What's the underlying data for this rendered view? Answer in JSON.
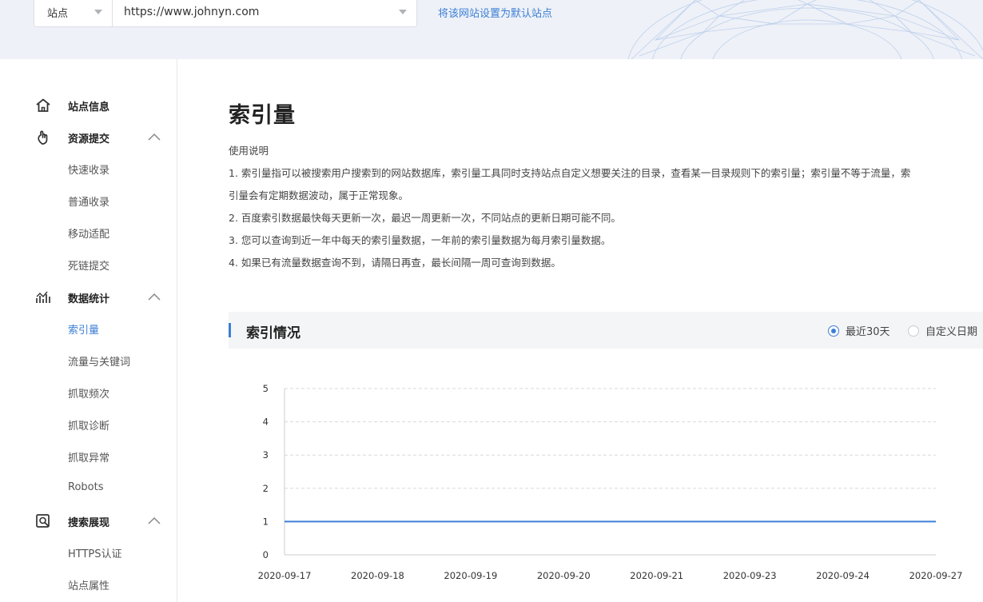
{
  "header": {
    "site_type": "站点",
    "site_url": "https://www.johnyn.com",
    "set_default_link": "将该网站设置为默认站点"
  },
  "sidebar": {
    "groups": [
      {
        "label": "站点信息",
        "icon": "home-icon"
      },
      {
        "label": "资源提交",
        "icon": "submit-icon",
        "items": [
          "快速收录",
          "普通收录",
          "移动适配",
          "死链提交"
        ]
      },
      {
        "label": "数据统计",
        "icon": "stats-icon",
        "items": [
          "索引量",
          "流量与关键词",
          "抓取频次",
          "抓取诊断",
          "抓取异常",
          "Robots"
        ]
      },
      {
        "label": "搜索展现",
        "icon": "search-display-icon",
        "items": [
          "HTTPS认证",
          "站点属性"
        ]
      }
    ],
    "active_item": "索引量"
  },
  "main": {
    "title": "索引量",
    "usage_title": "使用说明",
    "usage_lines": [
      "1. 索引量指可以被搜索用户搜索到的网站数据库，索引量工具同时支持站点自定义想要关注的目录，查看某一目录规则下的索引量；索引量不等于流量，索",
      "引量会有定期数据波动，属于正常现象。",
      "2. 百度索引数据最快每天更新一次，最迟一周更新一次，不同站点的更新日期可能不同。",
      "3. 您可以查询到近一年中每天的索引量数据，一年前的索引量数据为每月索引量数据。",
      "4. 如果已有流量数据查询不到，请隔日再查，最长间隔一周可查询到数据。"
    ],
    "section_title": "索引情况",
    "range_options": [
      {
        "label": "最近30天",
        "checked": true
      },
      {
        "label": "自定义日期",
        "checked": false
      }
    ]
  },
  "colors": {
    "accent": "#3c7fd6",
    "line": "#3c7fd6",
    "grid": "#d9d9d9"
  },
  "chart_data": {
    "type": "line",
    "title": "",
    "xlabel": "",
    "ylabel": "",
    "x": [
      "2020-09-17",
      "2020-09-18",
      "2020-09-19",
      "2020-09-20",
      "2020-09-21",
      "2020-09-23",
      "2020-09-24",
      "2020-09-27"
    ],
    "series": [
      {
        "values": [
          1,
          1,
          1,
          1,
          1,
          1,
          1,
          1
        ]
      }
    ],
    "ylim": [
      0,
      5
    ],
    "yticks": [
      0,
      1,
      2,
      3,
      4,
      5
    ],
    "grid": true
  }
}
